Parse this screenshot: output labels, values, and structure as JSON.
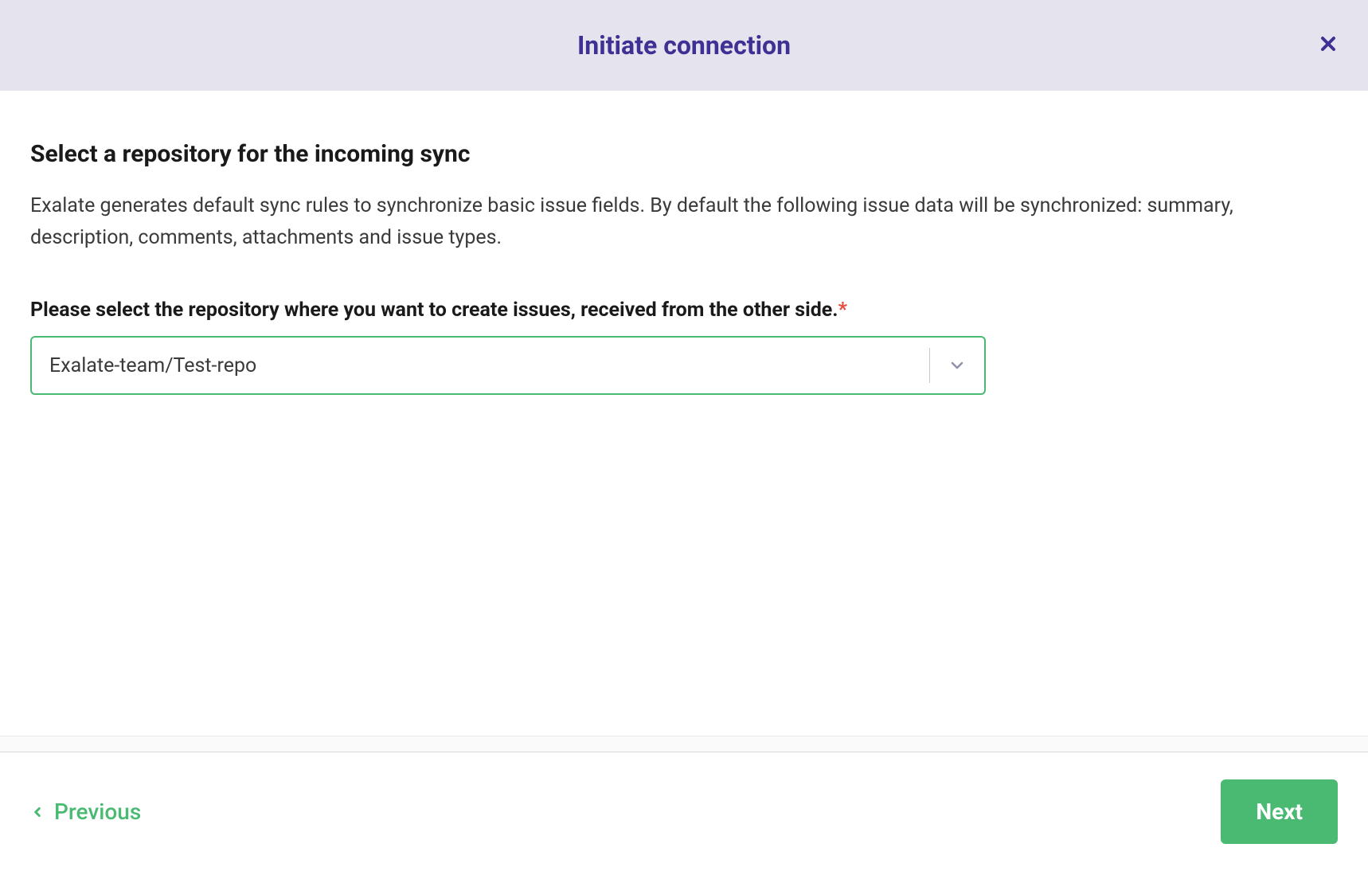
{
  "header": {
    "title": "Initiate connection"
  },
  "content": {
    "heading": "Select a repository for the incoming sync",
    "description": "Exalate generates default sync rules to synchronize basic issue fields. By default the following issue data will be synchronized: summary, description, comments, attachments and issue types.",
    "fieldLabel": "Please select the repository where you want to create issues, received from the other side.",
    "selectedRepo": "Exalate-team/Test-repo"
  },
  "footer": {
    "previousLabel": "Previous",
    "nextLabel": "Next"
  }
}
